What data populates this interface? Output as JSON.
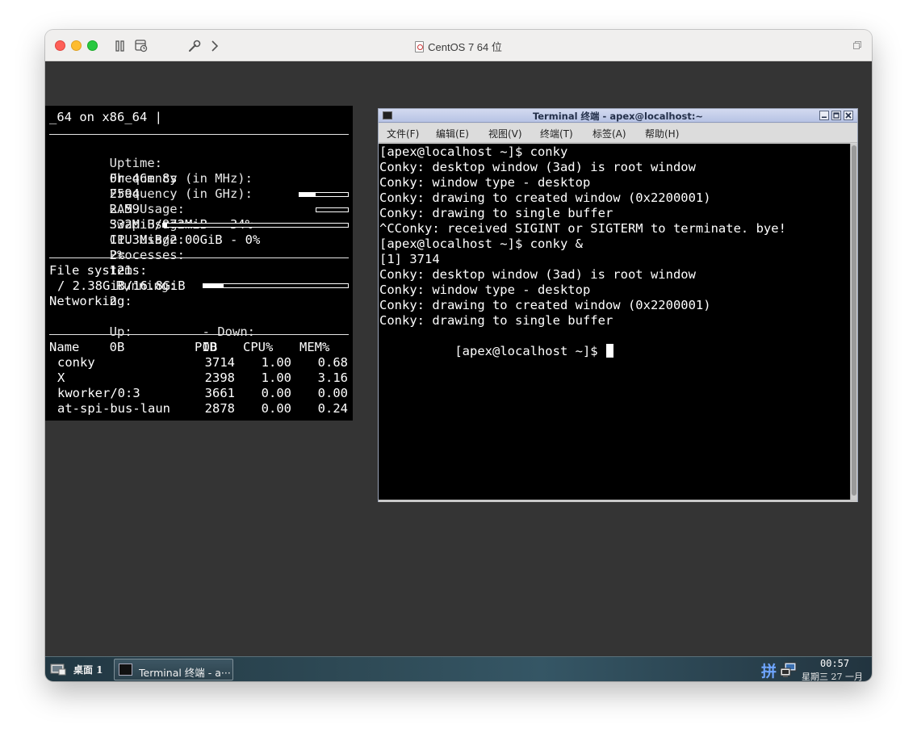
{
  "vm_window": {
    "title": "CentOS 7 64 位"
  },
  "conky": {
    "header": "_64 on x86_64 |",
    "uptime": {
      "label": "Uptime:",
      "value": "0h 46m 8s"
    },
    "freq_mhz": {
      "label": "Frequency (in MHz):",
      "value": "2594"
    },
    "freq_ghz": {
      "label": "Frequency (in GHz):",
      "value": "2.59"
    },
    "ram": {
      "label": "RAM Usage:",
      "value": "332MiB/972MiB - 34%",
      "percent": 34
    },
    "swap": {
      "label": "Swap Usage:",
      "value": "11.3MiB/2.00GiB - 0%",
      "percent": 0
    },
    "cpu": {
      "label": "CPU Usage:",
      "value": "2%",
      "percent": 2
    },
    "processes": {
      "label": "Processes:",
      "value": "121",
      "running_label": "Running:",
      "running_value": "2"
    },
    "filesystems": {
      "label": "File systems:",
      "root": "/ 2.38GiB/16.8GiB",
      "percent": 14
    },
    "networking": {
      "label": "Networking:",
      "up_label": "Up:",
      "up_value": "0B",
      "down_label": "- Down:",
      "down_value": "0B"
    },
    "process_table": {
      "headers": [
        "Name",
        "PID",
        "CPU%",
        "MEM%"
      ],
      "rows": [
        {
          "name": "conky",
          "pid": "3714",
          "cpu": "1.00",
          "mem": "0.68"
        },
        {
          "name": "X",
          "pid": "2398",
          "cpu": "1.00",
          "mem": "3.16"
        },
        {
          "name": "kworker/0:3",
          "pid": "3661",
          "cpu": "0.00",
          "mem": "0.00"
        },
        {
          "name": "at-spi-bus-laun",
          "pid": "2878",
          "cpu": "0.00",
          "mem": "0.24"
        }
      ]
    }
  },
  "terminal": {
    "title": "Terminal 终端 - apex@localhost:~",
    "menu": [
      "文件(F)",
      "编辑(E)",
      "视图(V)",
      "终端(T)",
      "标签(A)",
      "帮助(H)"
    ],
    "lines": [
      "[apex@localhost ~]$ conky",
      "Conky: desktop window (3ad) is root window",
      "Conky: window type - desktop",
      "Conky: drawing to created window (0x2200001)",
      "Conky: drawing to single buffer",
      "^CConky: received SIGINT or SIGTERM to terminate. bye!",
      "[apex@localhost ~]$ conky &",
      "[1] 3714",
      "Conky: desktop window (3ad) is root window",
      "Conky: window type - desktop",
      "Conky: drawing to created window (0x2200001)",
      "Conky: drawing to single buffer"
    ],
    "prompt": "[apex@localhost ~]$ "
  },
  "taskbar": {
    "workspace": "桌面 1",
    "task_label": "Terminal 终端 - a···",
    "ime": "拼",
    "time": "00:57",
    "date": "星期三 27 一月"
  }
}
